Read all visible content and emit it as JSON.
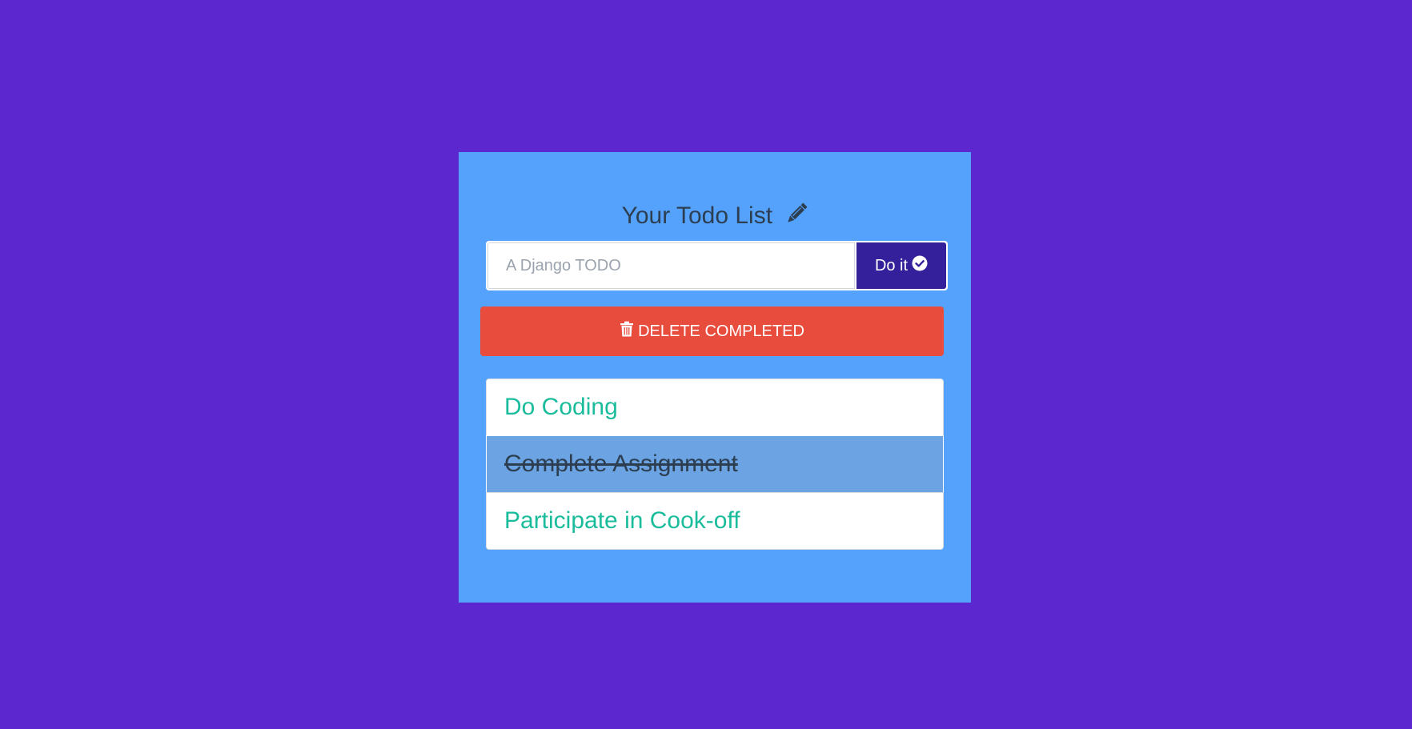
{
  "page": {
    "title": "Your Todo List",
    "title_icon": "pencil-icon"
  },
  "form": {
    "input_placeholder": "A Django TODO",
    "input_value": "",
    "submit_label": "Do it",
    "submit_icon": "check-circle-icon"
  },
  "actions": {
    "delete_completed_label": "DELETE COMPLETED",
    "delete_completed_icon": "trash-icon"
  },
  "todos": [
    {
      "text": "Do Coding",
      "completed": false
    },
    {
      "text": "Complete Assignment",
      "completed": true
    },
    {
      "text": "Participate in Cook-off",
      "completed": false
    }
  ],
  "colors": {
    "background": "#5d27cf",
    "card": "#55a2fd",
    "submit_button": "#34209a",
    "delete_button": "#e74c3c",
    "todo_text": "#1abc9c",
    "completed_bg": "#6ba3e3",
    "completed_text": "#2c3e50"
  }
}
